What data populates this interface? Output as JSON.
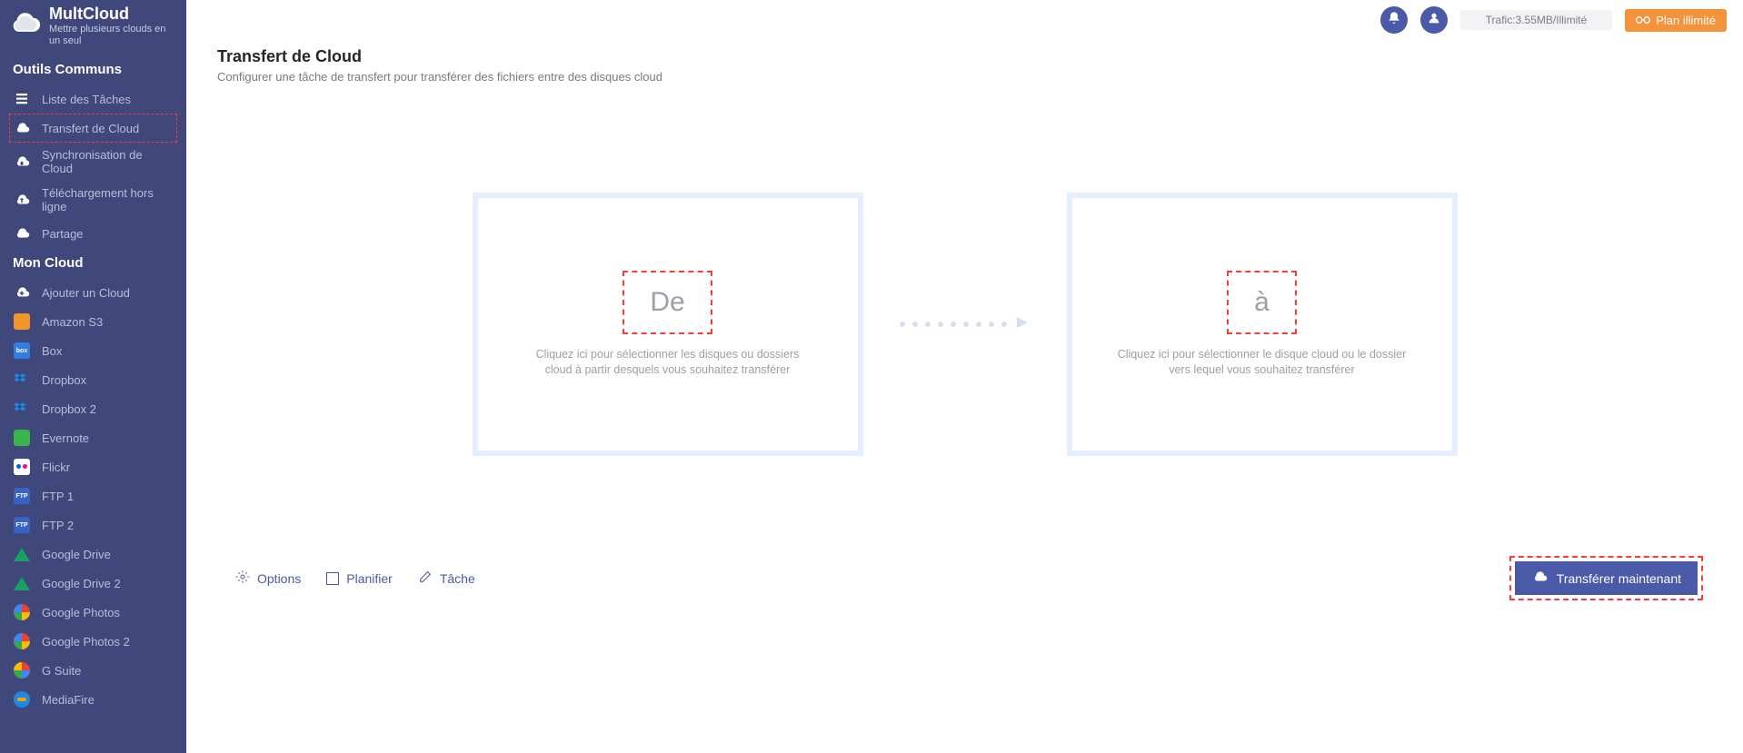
{
  "brand": {
    "name": "MultCloud",
    "tagline": "Mettre plusieurs clouds en un seul"
  },
  "sidebar": {
    "section_common": "Outils Communs",
    "items_common": [
      {
        "label": "Liste des Tâches"
      },
      {
        "label": "Transfert de Cloud"
      },
      {
        "label": "Synchronisation de Cloud"
      },
      {
        "label": "Téléchargement hors ligne"
      },
      {
        "label": "Partage"
      }
    ],
    "section_my": "Mon Cloud",
    "items_my": [
      {
        "label": "Ajouter un Cloud"
      },
      {
        "label": "Amazon S3"
      },
      {
        "label": "Box"
      },
      {
        "label": "Dropbox"
      },
      {
        "label": "Dropbox 2"
      },
      {
        "label": "Evernote"
      },
      {
        "label": "Flickr"
      },
      {
        "label": "FTP 1"
      },
      {
        "label": "FTP 2"
      },
      {
        "label": "Google Drive"
      },
      {
        "label": "Google Drive 2"
      },
      {
        "label": "Google Photos"
      },
      {
        "label": "Google Photos 2"
      },
      {
        "label": "G Suite"
      },
      {
        "label": "MediaFire"
      }
    ]
  },
  "topbar": {
    "traffic": "Trafic:3.55MB/Illimité",
    "upgrade": "Plan illimité"
  },
  "page": {
    "title": "Transfert de Cloud",
    "subtitle": "Configurer une tâche de transfert pour transférer des fichiers entre des disques cloud"
  },
  "transfer": {
    "from_label": "De",
    "from_help": "Cliquez ici pour sélectionner les disques ou dossiers cloud à partir desquels vous souhaitez transférer",
    "to_label": "à",
    "to_help": "Cliquez ici pour sélectionner le disque cloud ou le dossier vers lequel vous souhaitez transférer"
  },
  "actions": {
    "options": "Options",
    "schedule": "Planifier",
    "task": "Tâche",
    "transfer_now": "Transférer maintenant"
  }
}
